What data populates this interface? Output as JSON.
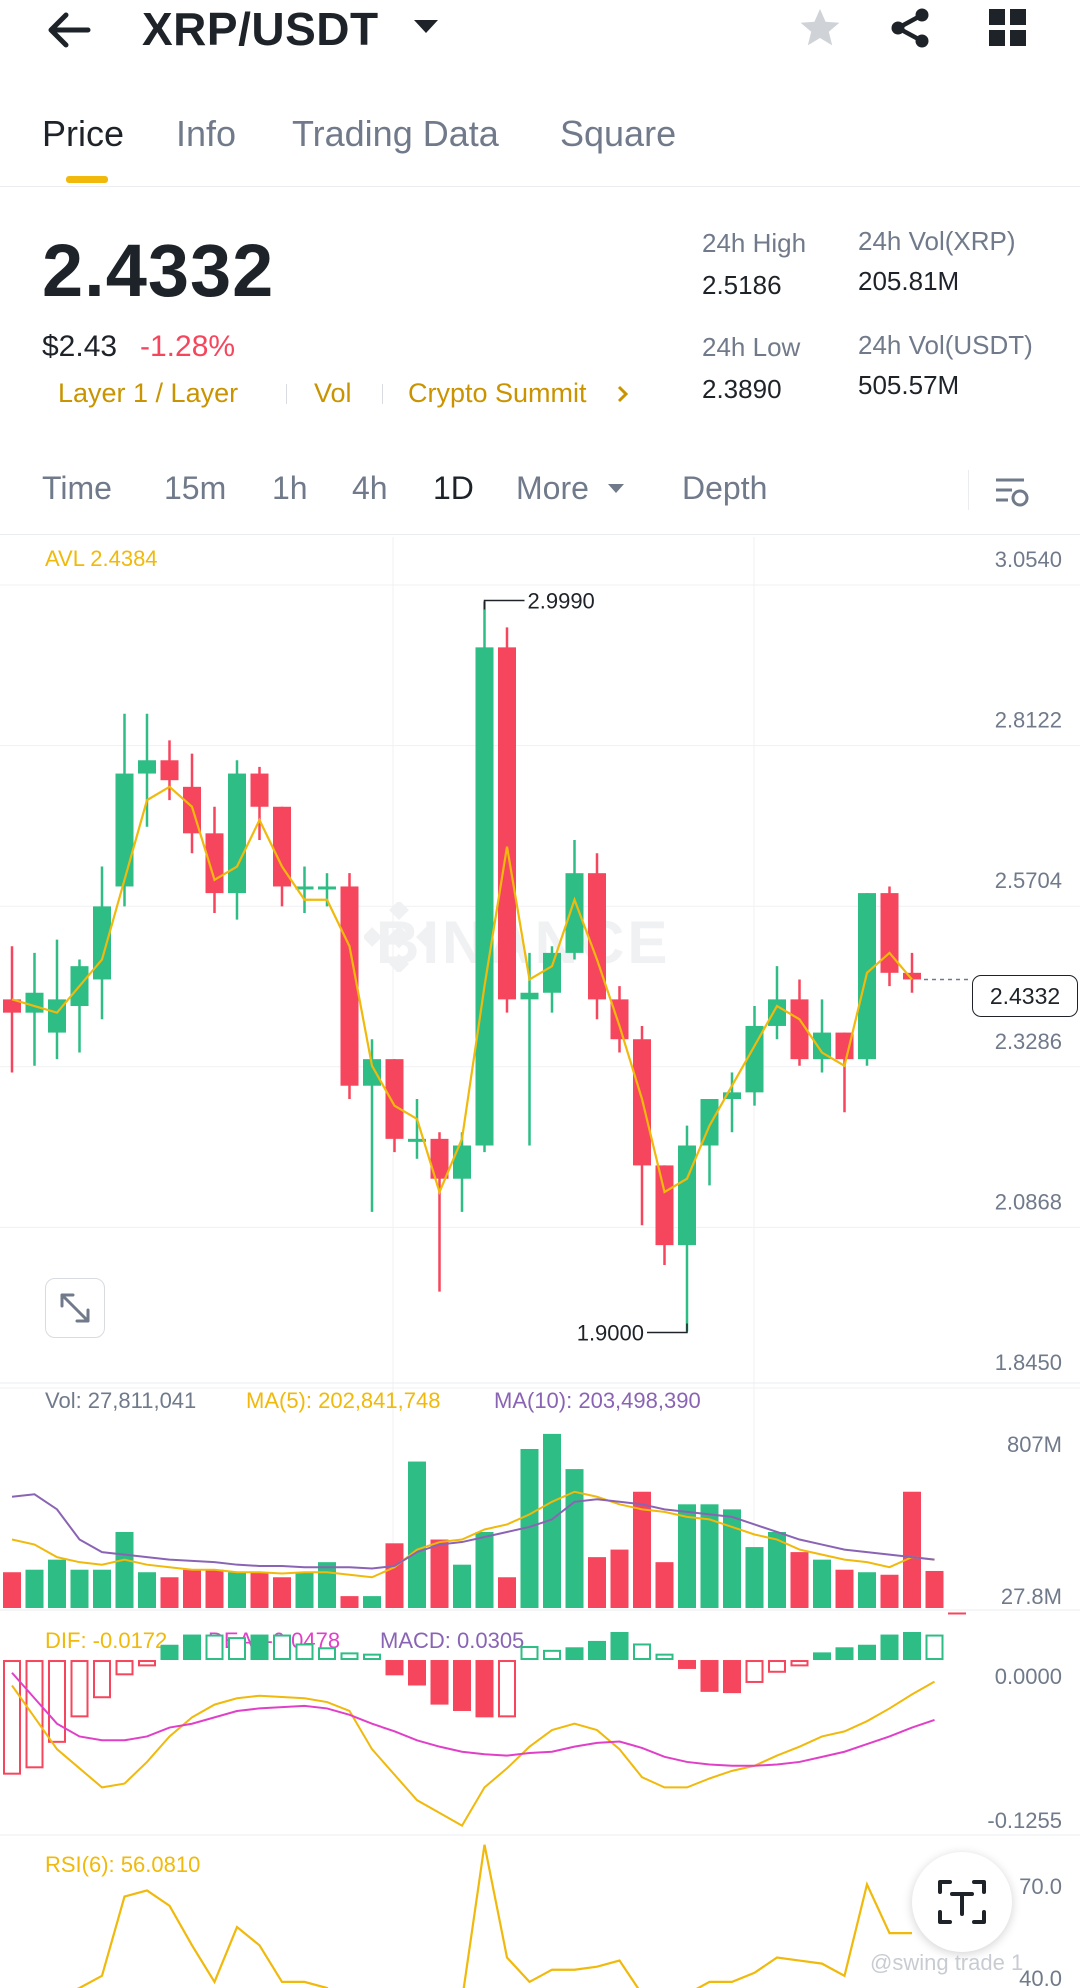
{
  "header": {
    "pair": "XRP/USDT",
    "icons": [
      "back-arrow-icon",
      "star-icon",
      "share-icon",
      "grid-icon"
    ]
  },
  "tabs": [
    {
      "label": "Price",
      "active": true
    },
    {
      "label": "Info",
      "active": false
    },
    {
      "label": "Trading Data",
      "active": false
    },
    {
      "label": "Square",
      "active": false
    }
  ],
  "ticker": {
    "last_price": "2.4332",
    "fiat_price": "$2.43",
    "change": "-1.28%",
    "tags": [
      "Layer 1 / Layer",
      "Vol",
      "Crypto Summit"
    ],
    "high_label": "24h High",
    "high_value": "2.5186",
    "low_label": "24h Low",
    "low_value": "2.3890",
    "vol_coin_label": "24h Vol(XRP)",
    "vol_coin_value": "205.81M",
    "vol_quote_label": "24h Vol(USDT)",
    "vol_quote_value": "505.57M"
  },
  "intervals": {
    "items": [
      "Time",
      "15m",
      "1h",
      "4h",
      "1D",
      "More",
      "Depth"
    ],
    "active": "1D"
  },
  "colors": {
    "up": "#2ebd85",
    "down": "#f6465d",
    "yellow": "#f0b90b",
    "purple": "#8a64b4",
    "magenta": "#e040c8",
    "gold_text": "#c99400"
  },
  "chart_data": {
    "type": "candlestick",
    "avl_label": "AVL 2.4384",
    "price_axis": [
      "3.0540",
      "2.8122",
      "2.5704",
      "2.3286",
      "2.0868",
      "1.8450"
    ],
    "ylim": [
      1.845,
      3.054
    ],
    "high_marker": "2.9990",
    "low_marker": "1.9000",
    "last_price_label": "2.4332",
    "watermark": "BINANCE",
    "candles": [
      {
        "o": 2.4,
        "h": 2.48,
        "l": 2.29,
        "c": 2.38
      },
      {
        "o": 2.38,
        "h": 2.47,
        "l": 2.3,
        "c": 2.41
      },
      {
        "o": 2.35,
        "h": 2.49,
        "l": 2.31,
        "c": 2.4
      },
      {
        "o": 2.39,
        "h": 2.46,
        "l": 2.32,
        "c": 2.45
      },
      {
        "o": 2.43,
        "h": 2.6,
        "l": 2.37,
        "c": 2.54
      },
      {
        "o": 2.57,
        "h": 2.83,
        "l": 2.54,
        "c": 2.74
      },
      {
        "o": 2.74,
        "h": 2.83,
        "l": 2.66,
        "c": 2.76
      },
      {
        "o": 2.76,
        "h": 2.79,
        "l": 2.7,
        "c": 2.73
      },
      {
        "o": 2.72,
        "h": 2.77,
        "l": 2.62,
        "c": 2.65
      },
      {
        "o": 2.65,
        "h": 2.69,
        "l": 2.53,
        "c": 2.56
      },
      {
        "o": 2.56,
        "h": 2.76,
        "l": 2.52,
        "c": 2.74
      },
      {
        "o": 2.74,
        "h": 2.75,
        "l": 2.64,
        "c": 2.69
      },
      {
        "o": 2.69,
        "h": 2.69,
        "l": 2.54,
        "c": 2.57
      },
      {
        "o": 2.57,
        "h": 2.6,
        "l": 2.53,
        "c": 2.57
      },
      {
        "o": 2.57,
        "h": 2.59,
        "l": 2.54,
        "c": 2.57
      },
      {
        "o": 2.57,
        "h": 2.59,
        "l": 2.25,
        "c": 2.27
      },
      {
        "o": 2.27,
        "h": 2.34,
        "l": 2.08,
        "c": 2.31
      },
      {
        "o": 2.31,
        "h": 2.31,
        "l": 2.17,
        "c": 2.19
      },
      {
        "o": 2.19,
        "h": 2.25,
        "l": 2.16,
        "c": 2.19
      },
      {
        "o": 2.19,
        "h": 2.2,
        "l": 1.96,
        "c": 2.13
      },
      {
        "o": 2.13,
        "h": 2.2,
        "l": 2.08,
        "c": 2.18
      },
      {
        "o": 2.18,
        "h": 2.999,
        "l": 2.17,
        "c": 2.93
      },
      {
        "o": 2.93,
        "h": 2.96,
        "l": 2.38,
        "c": 2.4
      },
      {
        "o": 2.4,
        "h": 2.47,
        "l": 2.18,
        "c": 2.41
      },
      {
        "o": 2.41,
        "h": 2.48,
        "l": 2.38,
        "c": 2.47
      },
      {
        "o": 2.47,
        "h": 2.64,
        "l": 2.46,
        "c": 2.59
      },
      {
        "o": 2.59,
        "h": 2.62,
        "l": 2.37,
        "c": 2.4
      },
      {
        "o": 2.4,
        "h": 2.42,
        "l": 2.32,
        "c": 2.34
      },
      {
        "o": 2.34,
        "h": 2.36,
        "l": 2.06,
        "c": 2.15
      },
      {
        "o": 2.15,
        "h": 2.15,
        "l": 2.0,
        "c": 2.03
      },
      {
        "o": 2.03,
        "h": 2.21,
        "l": 1.9,
        "c": 2.18
      },
      {
        "o": 2.18,
        "h": 2.23,
        "l": 2.12,
        "c": 2.25
      },
      {
        "o": 2.25,
        "h": 2.29,
        "l": 2.2,
        "c": 2.26
      },
      {
        "o": 2.26,
        "h": 2.39,
        "l": 2.24,
        "c": 2.36
      },
      {
        "o": 2.36,
        "h": 2.45,
        "l": 2.34,
        "c": 2.4
      },
      {
        "o": 2.4,
        "h": 2.43,
        "l": 2.3,
        "c": 2.31
      },
      {
        "o": 2.31,
        "h": 2.4,
        "l": 2.29,
        "c": 2.35
      },
      {
        "o": 2.35,
        "h": 2.35,
        "l": 2.23,
        "c": 2.31
      },
      {
        "o": 2.31,
        "h": 2.56,
        "l": 2.3,
        "c": 2.56
      },
      {
        "o": 2.56,
        "h": 2.57,
        "l": 2.42,
        "c": 2.44
      },
      {
        "o": 2.44,
        "h": 2.47,
        "l": 2.41,
        "c": 2.43
      }
    ],
    "ma_line": [
      2.4,
      2.39,
      2.38,
      2.42,
      2.46,
      2.58,
      2.7,
      2.72,
      2.69,
      2.58,
      2.6,
      2.67,
      2.6,
      2.55,
      2.55,
      2.48,
      2.3,
      2.24,
      2.22,
      2.11,
      2.19,
      2.42,
      2.63,
      2.43,
      2.45,
      2.55,
      2.46,
      2.36,
      2.25,
      2.11,
      2.13,
      2.21,
      2.27,
      2.33,
      2.39,
      2.37,
      2.32,
      2.3,
      2.44,
      2.47,
      2.43
    ],
    "volume": {
      "label": "Vol: 27,811,041",
      "ma5_label": "MA(5): 202,841,748",
      "ma10_label": "MA(10): 203,498,390",
      "axis_top": "807M",
      "axis_bottom": "27.8M",
      "ylim": [
        27.8,
        807
      ],
      "bars": [
        170,
        180,
        220,
        180,
        180,
        330,
        170,
        150,
        180,
        180,
        170,
        170,
        150,
        170,
        210,
        75,
        75,
        285,
        610,
        300,
        200,
        330,
        150,
        660,
        720,
        580,
        230,
        260,
        490,
        210,
        440,
        440,
        420,
        270,
        330,
        250,
        220,
        180,
        170,
        160,
        490,
        175,
        10
      ],
      "ma5": [
        300,
        280,
        230,
        210,
        200,
        220,
        200,
        190,
        180,
        180,
        170,
        170,
        165,
        170,
        170,
        160,
        150,
        190,
        260,
        290,
        300,
        340,
        360,
        400,
        450,
        490,
        470,
        440,
        420,
        410,
        390,
        380,
        350,
        320,
        300,
        260,
        240,
        220,
        210,
        190,
        230,
        220
      ],
      "ma10": [
        470,
        480,
        420,
        300,
        250,
        240,
        230,
        220,
        215,
        210,
        200,
        195,
        195,
        190,
        190,
        190,
        185,
        195,
        250,
        280,
        290,
        310,
        330,
        350,
        380,
        450,
        460,
        450,
        440,
        420,
        410,
        400,
        390,
        360,
        330,
        300,
        280,
        260,
        250,
        240,
        230,
        220
      ]
    },
    "macd": {
      "dif_label": "DIF: -0.0172",
      "dea_label": "DEA: -0.0478",
      "macd_label": "MACD: 0.0305",
      "axis_top": "0.0000",
      "axis_bottom": "-0.1255",
      "ylim": [
        -0.135,
        0.022
      ],
      "hist": [
        -0.09,
        -0.085,
        -0.065,
        -0.045,
        -0.03,
        -0.012,
        -0.005,
        0.012,
        0.02,
        0.02,
        0.018,
        0.02,
        0.02,
        0.013,
        0.01,
        0.006,
        0.005,
        -0.012,
        -0.02,
        -0.035,
        -0.04,
        -0.045,
        -0.045,
        0.011,
        0.008,
        0.01,
        0.015,
        0.022,
        0.013,
        0.005,
        -0.007,
        -0.025,
        -0.026,
        -0.018,
        -0.01,
        -0.005,
        0.006,
        0.01,
        0.012,
        0.02,
        0.022,
        0.02
      ],
      "dif": [
        -0.02,
        -0.045,
        -0.07,
        -0.085,
        -0.1,
        -0.097,
        -0.08,
        -0.06,
        -0.045,
        -0.035,
        -0.03,
        -0.028,
        -0.029,
        -0.03,
        -0.033,
        -0.04,
        -0.07,
        -0.09,
        -0.11,
        -0.12,
        -0.13,
        -0.1,
        -0.085,
        -0.068,
        -0.055,
        -0.05,
        -0.055,
        -0.07,
        -0.092,
        -0.1,
        -0.1,
        -0.093,
        -0.087,
        -0.083,
        -0.075,
        -0.068,
        -0.06,
        -0.056,
        -0.048,
        -0.038,
        -0.027,
        -0.017
      ],
      "dea": [
        -0.01,
        -0.03,
        -0.05,
        -0.06,
        -0.063,
        -0.063,
        -0.06,
        -0.053,
        -0.05,
        -0.045,
        -0.04,
        -0.038,
        -0.037,
        -0.036,
        -0.038,
        -0.043,
        -0.05,
        -0.056,
        -0.063,
        -0.068,
        -0.072,
        -0.074,
        -0.075,
        -0.073,
        -0.072,
        -0.068,
        -0.065,
        -0.064,
        -0.069,
        -0.076,
        -0.08,
        -0.082,
        -0.083,
        -0.083,
        -0.082,
        -0.08,
        -0.076,
        -0.072,
        -0.066,
        -0.06,
        -0.053,
        -0.047
      ]
    },
    "rsi": {
      "label": "RSI(6): 56.0810",
      "axis_top": "70.0",
      "axis_bottom": "40.0",
      "ylim": [
        38,
        80
      ],
      "values": [
        34,
        33,
        35,
        38,
        42,
        68,
        70,
        65,
        52,
        40,
        58,
        52,
        40,
        40,
        38,
        30,
        30,
        34,
        33,
        34,
        34,
        85,
        48,
        40,
        44,
        44,
        45,
        47,
        36,
        30,
        36,
        40,
        40,
        43,
        48,
        47,
        46,
        42,
        72,
        56,
        56
      ]
    }
  },
  "footer": {
    "watermark": "@swing trade 1"
  }
}
